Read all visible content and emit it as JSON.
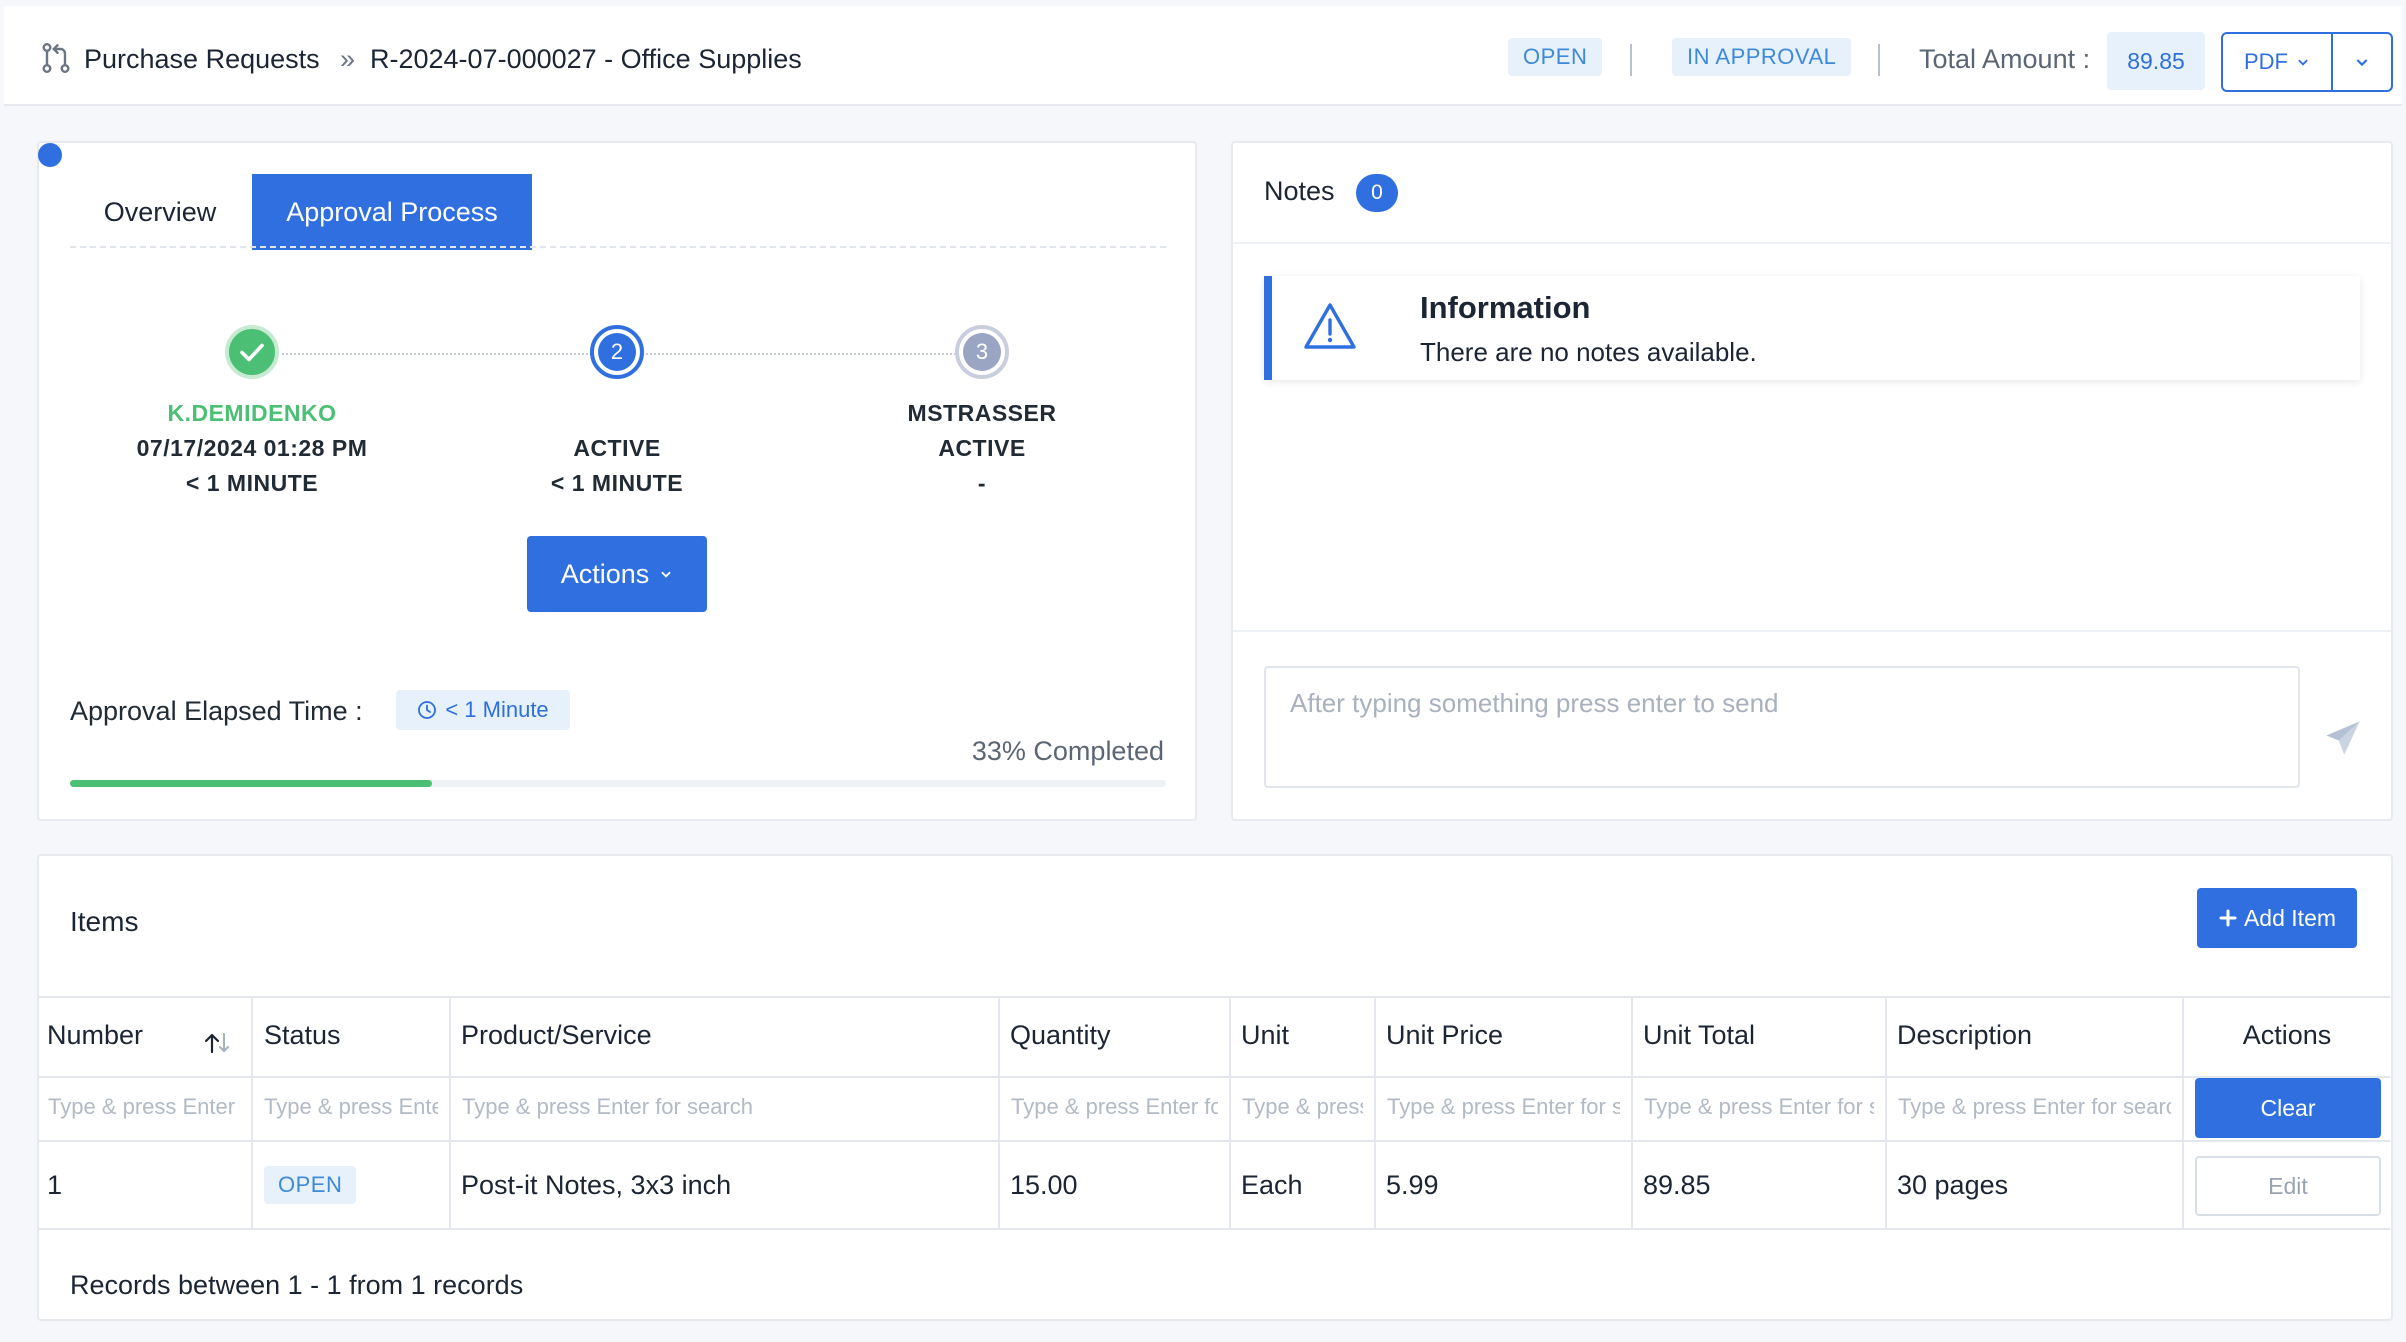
{
  "header": {
    "breadcrumb_root": "Purchase Requests",
    "breadcrumb_sep": "»",
    "breadcrumb_current": "R-2024-07-000027 - Office Supplies",
    "status_open": "OPEN",
    "status_approval": "IN APPROVAL",
    "total_label": "Total Amount :",
    "total_value": "89.85",
    "pdf_label": "PDF"
  },
  "approval_card": {
    "tabs": [
      {
        "label": "Overview",
        "active": false
      },
      {
        "label": "Approval Process",
        "active": true
      }
    ],
    "steps": [
      {
        "number": "1",
        "state": "completed",
        "name": "K.DEMIDENKO",
        "line2": "07/17/2024 01:28 PM",
        "line3": "< 1 MINUTE"
      },
      {
        "number": "2",
        "state": "current",
        "name": "",
        "line2": "ACTIVE",
        "line3": "< 1 MINUTE"
      },
      {
        "number": "3",
        "state": "pending",
        "name": "MSTRASSER",
        "line2": "ACTIVE",
        "line3": "-"
      }
    ],
    "actions_label": "Actions",
    "elapsed_label": "Approval Elapsed Time :",
    "elapsed_value": "< 1 Minute",
    "completed_text": "33% Completed",
    "progress_fraction": 0.33,
    "colors": {
      "accent": "#2f6fe0",
      "success": "#4bbf73",
      "pending": "#9aa5c3"
    }
  },
  "notes": {
    "title": "Notes",
    "count": "0",
    "info_title": "Information",
    "info_text": "There are no notes available.",
    "input_placeholder": "After typing something press enter to send"
  },
  "items": {
    "title": "Items",
    "add_label": "Add Item",
    "columns": [
      "Number",
      "Status",
      "Product/Service",
      "Quantity",
      "Unit",
      "Unit Price",
      "Unit Total",
      "Description",
      "Actions"
    ],
    "filters": [
      "Type & press Enter for search",
      "Type & press Enter for search",
      "Type & press Enter for search",
      "Type & press Enter for search",
      "Type & press Enter for search",
      "Type & press Enter for search",
      "Type & press Enter for search",
      "Type & press Enter for search"
    ],
    "clear_label": "Clear",
    "rows": [
      {
        "number": "1",
        "status": "OPEN",
        "product": "Post-it Notes, 3x3 inch",
        "quantity": "15.00",
        "unit": "Each",
        "unit_price": "5.99",
        "unit_total": "89.85",
        "description": "30 pages",
        "action": "Edit"
      }
    ],
    "footer": "Records between 1 - 1 from 1 records"
  }
}
